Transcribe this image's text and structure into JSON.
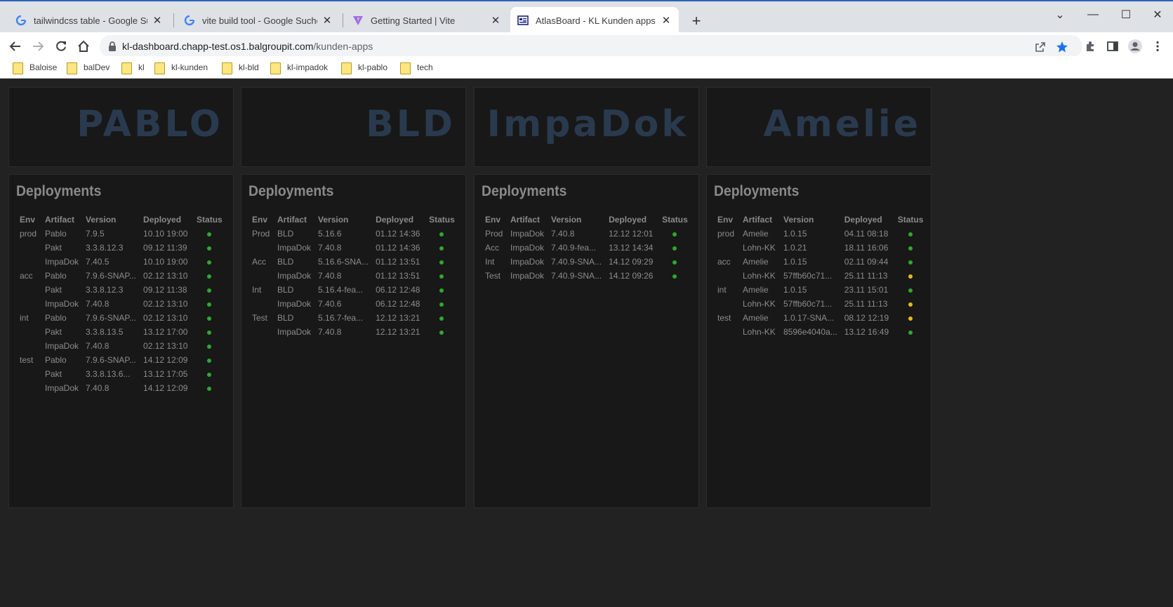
{
  "browser": {
    "tabs": [
      {
        "title": "tailwindcss table - Google Suche",
        "icon": "google-icon"
      },
      {
        "title": "vite build tool - Google Suche",
        "icon": "google-icon"
      },
      {
        "title": "Getting Started | Vite",
        "icon": "vite-icon"
      },
      {
        "title": "AtlasBoard - KL Kunden apps Wa",
        "icon": "dashboard-icon"
      }
    ],
    "url_host": "kl-dashboard.chapp-test.os1.balgroupit.com",
    "url_path": "/kunden-apps",
    "bookmarks": [
      "Baloise",
      "balDev",
      "kl",
      "kl-kunden",
      "kl-bld",
      "kl-impadok",
      "kl-pablo",
      "tech"
    ]
  },
  "colors": {
    "ok": "#2ea82e",
    "warn": "#e6b820"
  },
  "dashboard": {
    "section_title": "Deployments",
    "headers": [
      "Env",
      "Artifact",
      "Version",
      "Deployed",
      "Status"
    ],
    "apps": [
      {
        "name": "PABLO",
        "rows": [
          {
            "env": "prod",
            "artifact": "Pablo",
            "version": "7.9.5",
            "deployed": "10.10 19:00",
            "status": "ok"
          },
          {
            "env": "",
            "artifact": "Pakt",
            "version": "3.3.8.12.3",
            "deployed": "09.12 11:39",
            "status": "ok"
          },
          {
            "env": "",
            "artifact": "ImpaDok",
            "version": "7.40.5",
            "deployed": "10.10 19:00",
            "status": "ok"
          },
          {
            "env": "acc",
            "artifact": "Pablo",
            "version": "7.9.6-SNAP...",
            "deployed": "02.12 13:10",
            "status": "ok"
          },
          {
            "env": "",
            "artifact": "Pakt",
            "version": "3.3.8.12.3",
            "deployed": "09.12 11:38",
            "status": "ok"
          },
          {
            "env": "",
            "artifact": "ImpaDok",
            "version": "7.40.8",
            "deployed": "02.12 13:10",
            "status": "ok"
          },
          {
            "env": "int",
            "artifact": "Pablo",
            "version": "7.9.6-SNAP...",
            "deployed": "02.12 13:10",
            "status": "ok"
          },
          {
            "env": "",
            "artifact": "Pakt",
            "version": "3.3.8.13.5",
            "deployed": "13.12 17:00",
            "status": "ok"
          },
          {
            "env": "",
            "artifact": "ImpaDok",
            "version": "7.40.8",
            "deployed": "02.12 13:10",
            "status": "ok"
          },
          {
            "env": "test",
            "artifact": "Pablo",
            "version": "7.9.6-SNAP...",
            "deployed": "14.12 12:09",
            "status": "ok"
          },
          {
            "env": "",
            "artifact": "Pakt",
            "version": "3.3.8.13.6...",
            "deployed": "13.12 17:05",
            "status": "ok"
          },
          {
            "env": "",
            "artifact": "ImpaDok",
            "version": "7.40.8",
            "deployed": "14.12 12:09",
            "status": "ok"
          }
        ]
      },
      {
        "name": "BLD",
        "rows": [
          {
            "env": "Prod",
            "artifact": "BLD",
            "version": "5.16.6",
            "deployed": "01.12 14:36",
            "status": "ok"
          },
          {
            "env": "",
            "artifact": "ImpaDok",
            "version": "7.40.8",
            "deployed": "01.12 14:36",
            "status": "ok"
          },
          {
            "env": "Acc",
            "artifact": "BLD",
            "version": "5.16.6-SNA...",
            "deployed": "01.12 13:51",
            "status": "ok"
          },
          {
            "env": "",
            "artifact": "ImpaDok",
            "version": "7.40.8",
            "deployed": "01.12 13:51",
            "status": "ok"
          },
          {
            "env": "Int",
            "artifact": "BLD",
            "version": "5.16.4-fea...",
            "deployed": "06.12 12:48",
            "status": "ok"
          },
          {
            "env": "",
            "artifact": "ImpaDok",
            "version": "7.40.6",
            "deployed": "06.12 12:48",
            "status": "ok"
          },
          {
            "env": "Test",
            "artifact": "BLD",
            "version": "5.16.7-fea...",
            "deployed": "12.12 13:21",
            "status": "ok"
          },
          {
            "env": "",
            "artifact": "ImpaDok",
            "version": "7.40.8",
            "deployed": "12.12 13:21",
            "status": "ok"
          }
        ]
      },
      {
        "name": "ImpaDok",
        "rows": [
          {
            "env": "Prod",
            "artifact": "ImpaDok",
            "version": "7.40.8",
            "deployed": "12.12 12:01",
            "status": "ok"
          },
          {
            "env": "Acc",
            "artifact": "ImpaDok",
            "version": "7.40.9-fea...",
            "deployed": "13.12 14:34",
            "status": "ok"
          },
          {
            "env": "Int",
            "artifact": "ImpaDok",
            "version": "7.40.9-SNA...",
            "deployed": "14.12 09:29",
            "status": "ok"
          },
          {
            "env": "Test",
            "artifact": "ImpaDok",
            "version": "7.40.9-SNA...",
            "deployed": "14.12 09:26",
            "status": "ok"
          }
        ]
      },
      {
        "name": "Amelie",
        "rows": [
          {
            "env": "prod",
            "artifact": "Amelie",
            "version": "1.0.15",
            "deployed": "04.11 08:18",
            "status": "ok"
          },
          {
            "env": "",
            "artifact": "Lohn-KK",
            "version": "1.0.21",
            "deployed": "18.11 16:06",
            "status": "ok"
          },
          {
            "env": "acc",
            "artifact": "Amelie",
            "version": "1.0.15",
            "deployed": "02.11 09:44",
            "status": "ok"
          },
          {
            "env": "",
            "artifact": "Lohn-KK",
            "version": "57ffb60c71...",
            "deployed": "25.11 11:13",
            "status": "warn"
          },
          {
            "env": "int",
            "artifact": "Amelie",
            "version": "1.0.15",
            "deployed": "23.11 15:01",
            "status": "ok"
          },
          {
            "env": "",
            "artifact": "Lohn-KK",
            "version": "57ffb60c71...",
            "deployed": "25.11 11:13",
            "status": "warn"
          },
          {
            "env": "test",
            "artifact": "Amelie",
            "version": "1.0.17-SNA...",
            "deployed": "08.12 12:19",
            "status": "warn"
          },
          {
            "env": "",
            "artifact": "Lohn-KK",
            "version": "8596e4040a...",
            "deployed": "13.12 16:49",
            "status": "ok"
          }
        ]
      }
    ]
  }
}
